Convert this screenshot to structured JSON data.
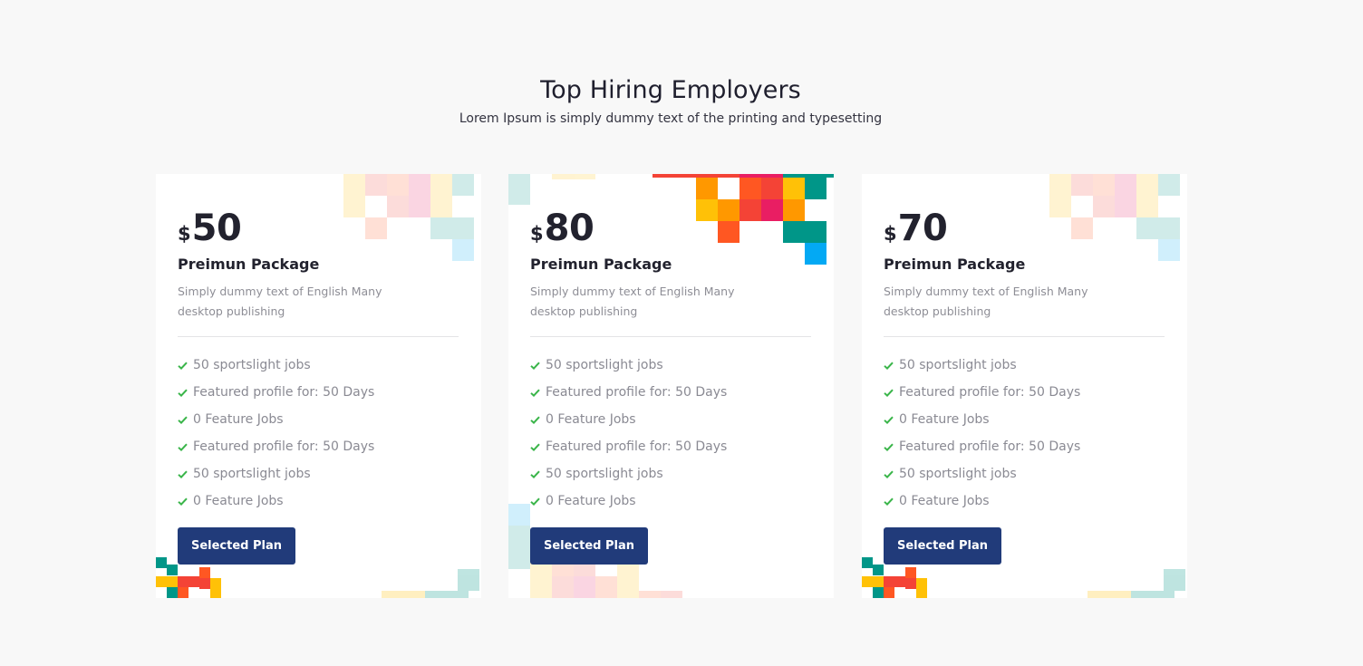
{
  "header": {
    "title": "Top Hiring Employers",
    "subtitle": "Lorem Ipsum is simply dummy text of the printing and typesetting"
  },
  "colors": {
    "background": "#f8f8f8",
    "card": "#ffffff",
    "button": "#213b7a",
    "check": "#3ab54a",
    "tiles": [
      "#f44336",
      "#ff5722",
      "#ffc107",
      "#ff9800",
      "#009688",
      "#e91e63",
      "#03a9f4"
    ]
  },
  "plans": [
    {
      "currency": "$",
      "price": "50",
      "title": "Preimun Package",
      "description": "Simply dummy text of English Many desktop publishing",
      "features": [
        "50 sportslight jobs",
        "Featured profile for: 50 Days",
        "0 Feature Jobs",
        "Featured profile for: 50 Days",
        "50 sportslight jobs",
        "0 Feature Jobs"
      ],
      "button": "Selected Plan"
    },
    {
      "currency": "$",
      "price": "80",
      "title": "Preimun Package",
      "description": "Simply dummy text of English Many desktop publishing",
      "features": [
        "50 sportslight jobs",
        "Featured profile for: 50 Days",
        "0 Feature Jobs",
        "Featured profile for: 50 Days",
        "50 sportslight jobs",
        "0 Feature Jobs"
      ],
      "button": "Selected Plan"
    },
    {
      "currency": "$",
      "price": "70",
      "title": "Preimun Package",
      "description": "Simply dummy text of English Many desktop publishing",
      "features": [
        "50 sportslight jobs",
        "Featured profile for: 50 Days",
        "0 Feature Jobs",
        "Featured profile for: 50 Days",
        "50 sportslight jobs",
        "0 Feature Jobs"
      ],
      "button": "Selected Plan"
    }
  ],
  "icons": {
    "feature_bullet": "check-icon",
    "decoration": "pixel-mosaic"
  }
}
